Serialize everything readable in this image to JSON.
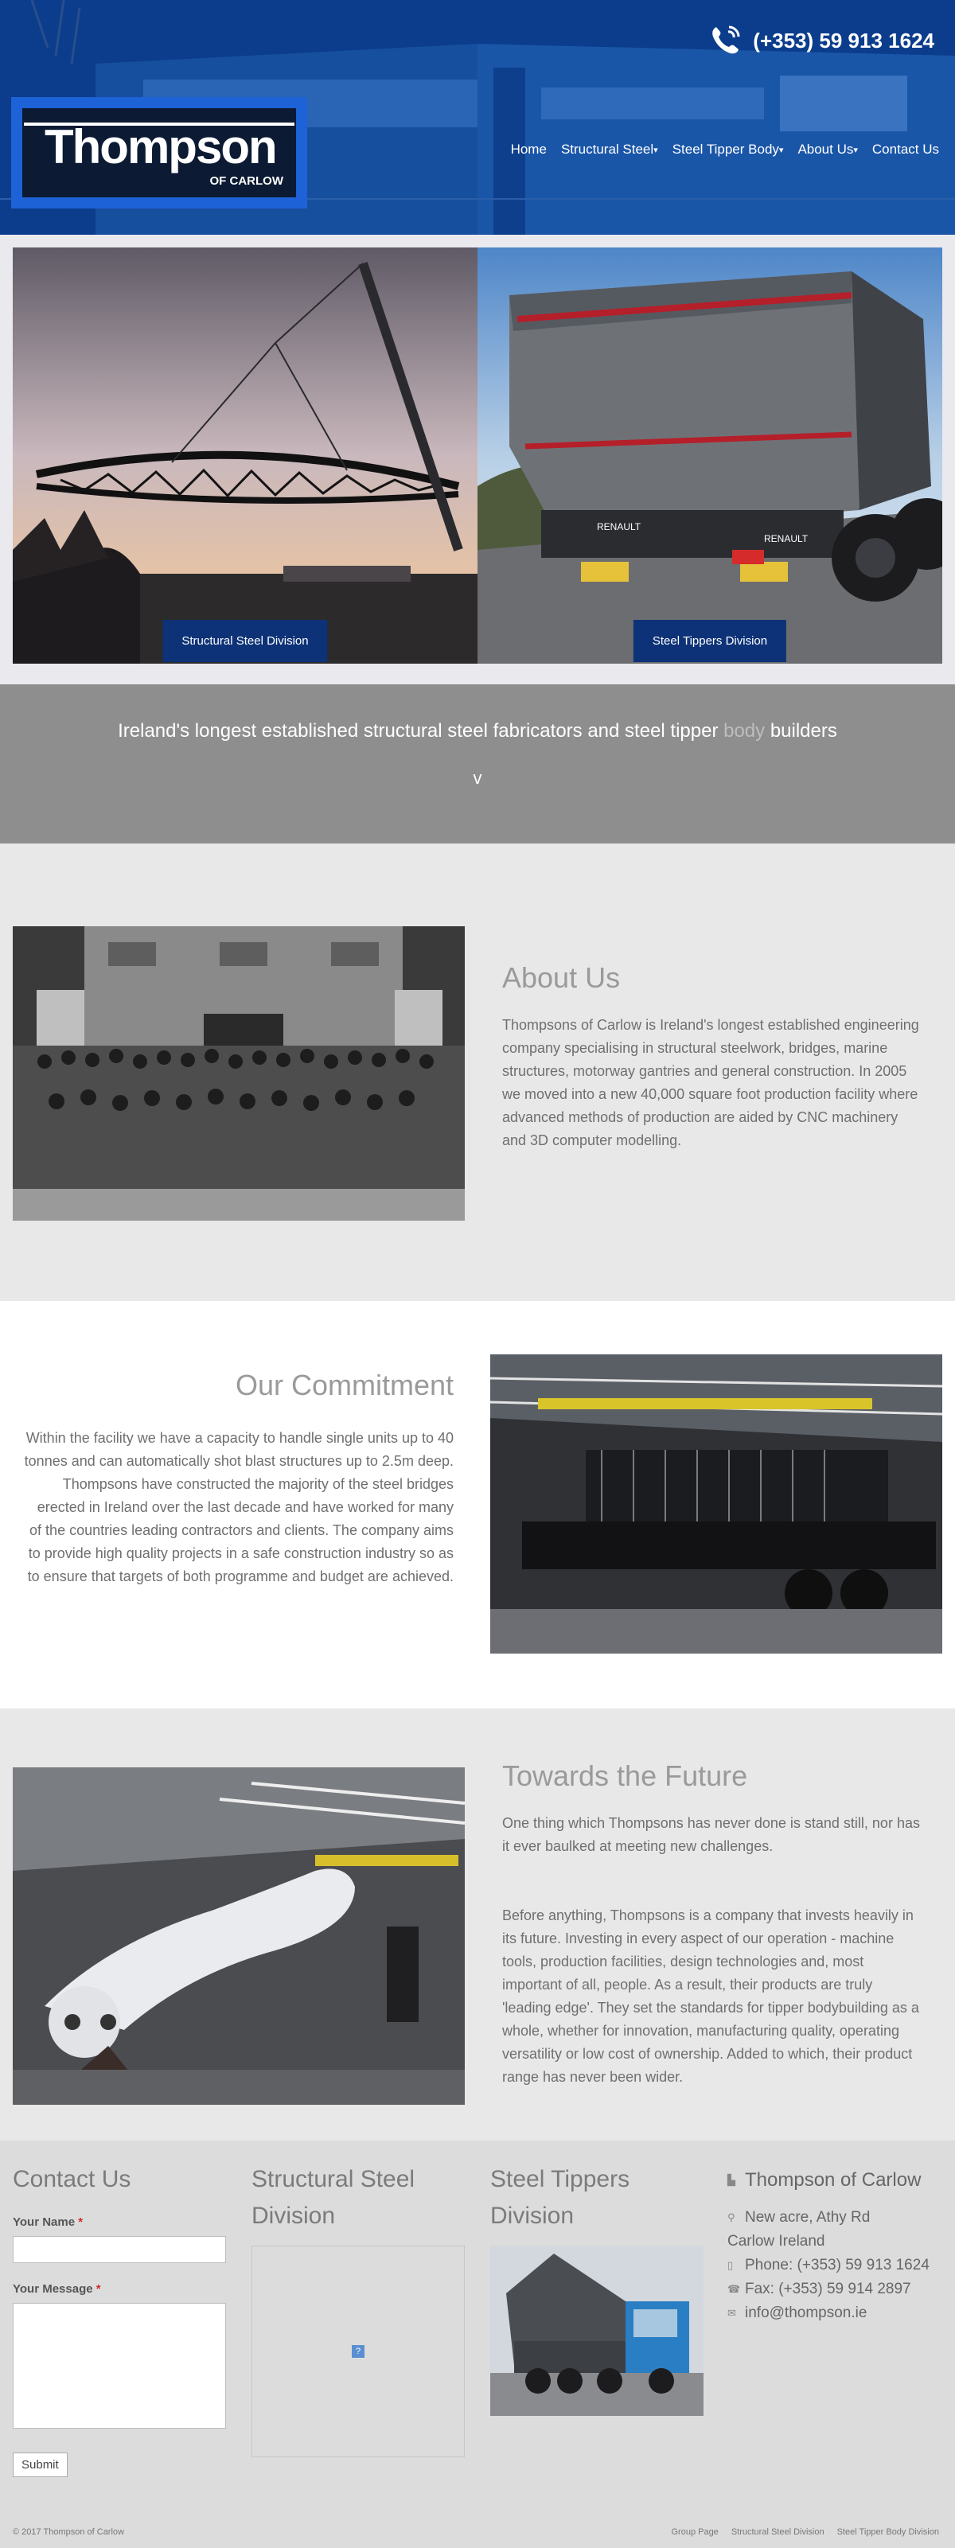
{
  "header": {
    "phone": "(+353) 59 913 1624",
    "logo": {
      "name": "Thompson",
      "sub": "OF CARLOW"
    },
    "nav": [
      {
        "label": "Home",
        "dropdown": false
      },
      {
        "label": "Structural Steel",
        "dropdown": true
      },
      {
        "label": "Steel Tipper Body",
        "dropdown": true
      },
      {
        "label": "About Us",
        "dropdown": true
      },
      {
        "label": "Contact Us",
        "dropdown": false
      }
    ]
  },
  "hero": {
    "left_label": "Structural Steel Division",
    "right_label": "Steel Tippers Division"
  },
  "tagline": {
    "before": "Ireland's longest established structural steel fabricators and steel tipper ",
    "highlight": "body",
    "after": " builders",
    "chevron": "v"
  },
  "about": {
    "title": "About Us",
    "body": "Thompsons of Carlow is Ireland's longest established engineering company specialising in structural steelwork, bridges, marine structures, motorway gantries and general construction. In 2005 we moved into a new 40,000 square foot production facility where advanced methods of production are aided by CNC machinery and 3D computer modelling."
  },
  "commitment": {
    "title": "Our Commitment",
    "body": "Within the facility we have a capacity to handle single units up to 40 tonnes and can automatically shot blast structures up to 2.5m deep. Thompsons have constructed the majority of the steel bridges erected in Ireland over the last decade and have worked for many of the countries leading contractors and clients. The company aims to provide high quality projects in a safe construction industry so as to ensure that targets of both programme and budget are achieved."
  },
  "future": {
    "title": "Towards the Future",
    "para1": "One thing which Thompsons has never done is stand still, nor has it ever baulked at meeting new challenges.",
    "para2": "Before anything, Thompsons is a company that invests heavily in its future. Investing in every aspect of our operation - machine tools, production facilities, design technologies and, most important of all, people. As a result, their products are truly 'leading edge'. They set the standards for tipper bodybuilding as a whole, whether for innovation, manufacturing quality, operating versatility or low cost of ownership. Added to which, their product range has never been wider."
  },
  "footer": {
    "contact": {
      "title": "Contact Us",
      "name_label": "Your Name",
      "message_label": "Your Message",
      "required_mark": "*",
      "submit": "Submit"
    },
    "structural": {
      "title_line1": "Structural Steel",
      "title_line2": "Division",
      "map_marker": "?"
    },
    "tippers": {
      "title_line1": "Steel Tippers",
      "title_line2": "Division"
    },
    "company": {
      "name": "Thompson of Carlow",
      "address1": "New acre, Athy Rd",
      "address2": "Carlow Ireland",
      "phone": "Phone: (+353) 59 913 1624",
      "fax": "Fax: (+353) 59 914 2897",
      "email": "info@thompson.ie"
    },
    "copyright": "© 2017 Thompson of Carlow",
    "links": [
      "Group Page",
      "Structural Steel Division",
      "Steel Tipper Body Division"
    ]
  }
}
